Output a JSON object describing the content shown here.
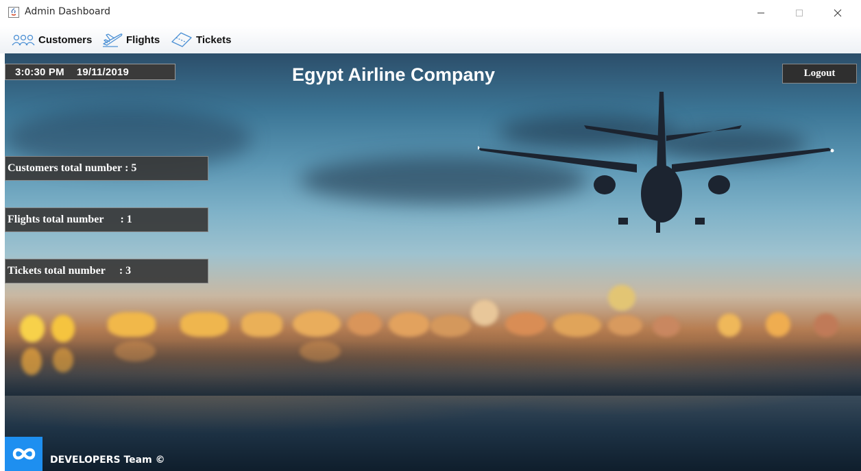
{
  "window": {
    "title": "Admin Dashboard",
    "controls": [
      "minimize",
      "maximize",
      "close"
    ]
  },
  "menubar": {
    "items": [
      {
        "label": "Customers",
        "icon": "customers-icon"
      },
      {
        "label": "Flights",
        "icon": "plane-icon"
      },
      {
        "label": "Tickets",
        "icon": "ticket-icon"
      }
    ]
  },
  "header": {
    "time": "3:0:30 PM",
    "date": "19/11/2019",
    "title": "Egypt Airline Company",
    "logout_label": "Logout"
  },
  "stats": [
    {
      "label": "Customers total number",
      "separator": " : ",
      "value": "5"
    },
    {
      "label": "Flights total number",
      "separator": "      : ",
      "value": "1"
    },
    {
      "label": "Tickets total number",
      "separator": "     : ",
      "value": "3"
    }
  ],
  "footer": {
    "text": "DEVELOPERS Team ©"
  },
  "colors": {
    "logo_blue": "#1e8ff0",
    "panel_dark": "#383838",
    "menubar_bg": "#eef1f5"
  }
}
